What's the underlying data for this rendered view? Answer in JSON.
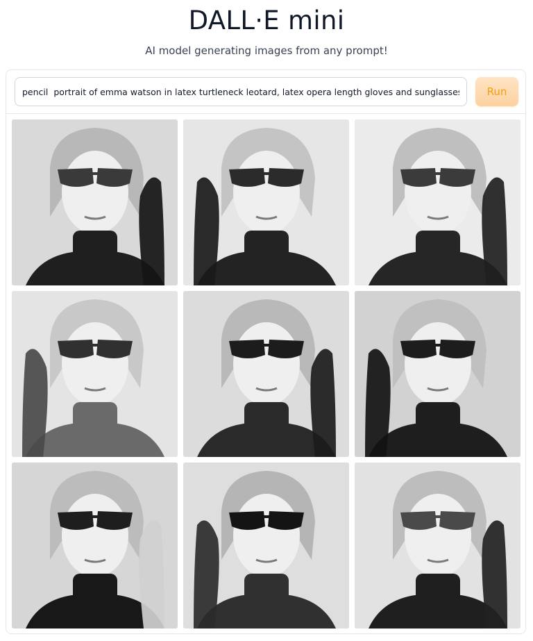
{
  "header": {
    "title": "DALL·E mini",
    "subtitle": "AI model generating images from any prompt!"
  },
  "prompt": {
    "value": "pencil  portrait of emma watson in latex turtleneck leotard, latex opera length gloves and sunglasses"
  },
  "run_button": {
    "label": "Run"
  },
  "colors": {
    "accent": "#f59e0b",
    "button_bg": "#fcd1a1",
    "border": "#e5e7eb"
  },
  "gallery": {
    "images": [
      {
        "name": "generated-image-1",
        "bg": "#d9d9d9",
        "hair": "#b8b8b8",
        "glasses": "#3a3a3a",
        "glove": "#151515",
        "neck": "#1f1f1f"
      },
      {
        "name": "generated-image-2",
        "bg": "#e6e6e6",
        "hair": "#c4c4c4",
        "glasses": "#2b2b2b",
        "glove": "#1a1a1a",
        "neck": "#232323"
      },
      {
        "name": "generated-image-3",
        "bg": "#ebebeb",
        "hair": "#bfbfbf",
        "glasses": "#3b3b3b",
        "glove": "#202020",
        "neck": "#262626"
      },
      {
        "name": "generated-image-4",
        "bg": "#e4e4e4",
        "hair": "#c8c8c8",
        "glasses": "#303030",
        "glove": "#4a4a4a",
        "neck": "#6a6a6a"
      },
      {
        "name": "generated-image-5",
        "bg": "#dcdcdc",
        "hair": "#b9b9b9",
        "glasses": "#1c1c1c",
        "glove": "#1b1b1b",
        "neck": "#2a2a2a"
      },
      {
        "name": "generated-image-6",
        "bg": "#d2d2d2",
        "hair": "#c0c0c0",
        "glasses": "#1d1d1d",
        "glove": "#121212",
        "neck": "#1e1e1e"
      },
      {
        "name": "generated-image-7",
        "bg": "#d6d6d6",
        "hair": "#bcbcbc",
        "glasses": "#1e1e1e",
        "glove": "#d0d0d0",
        "neck": "#181818"
      },
      {
        "name": "generated-image-8",
        "bg": "#dedede",
        "hair": "#b5b5b5",
        "glasses": "#141414",
        "glove": "#2b2b2b",
        "neck": "#303030"
      },
      {
        "name": "generated-image-9",
        "bg": "#e2e2e2",
        "hair": "#bdbdbd",
        "glasses": "#4a4a4a",
        "glove": "#222222",
        "neck": "#1f1f1f"
      }
    ]
  }
}
